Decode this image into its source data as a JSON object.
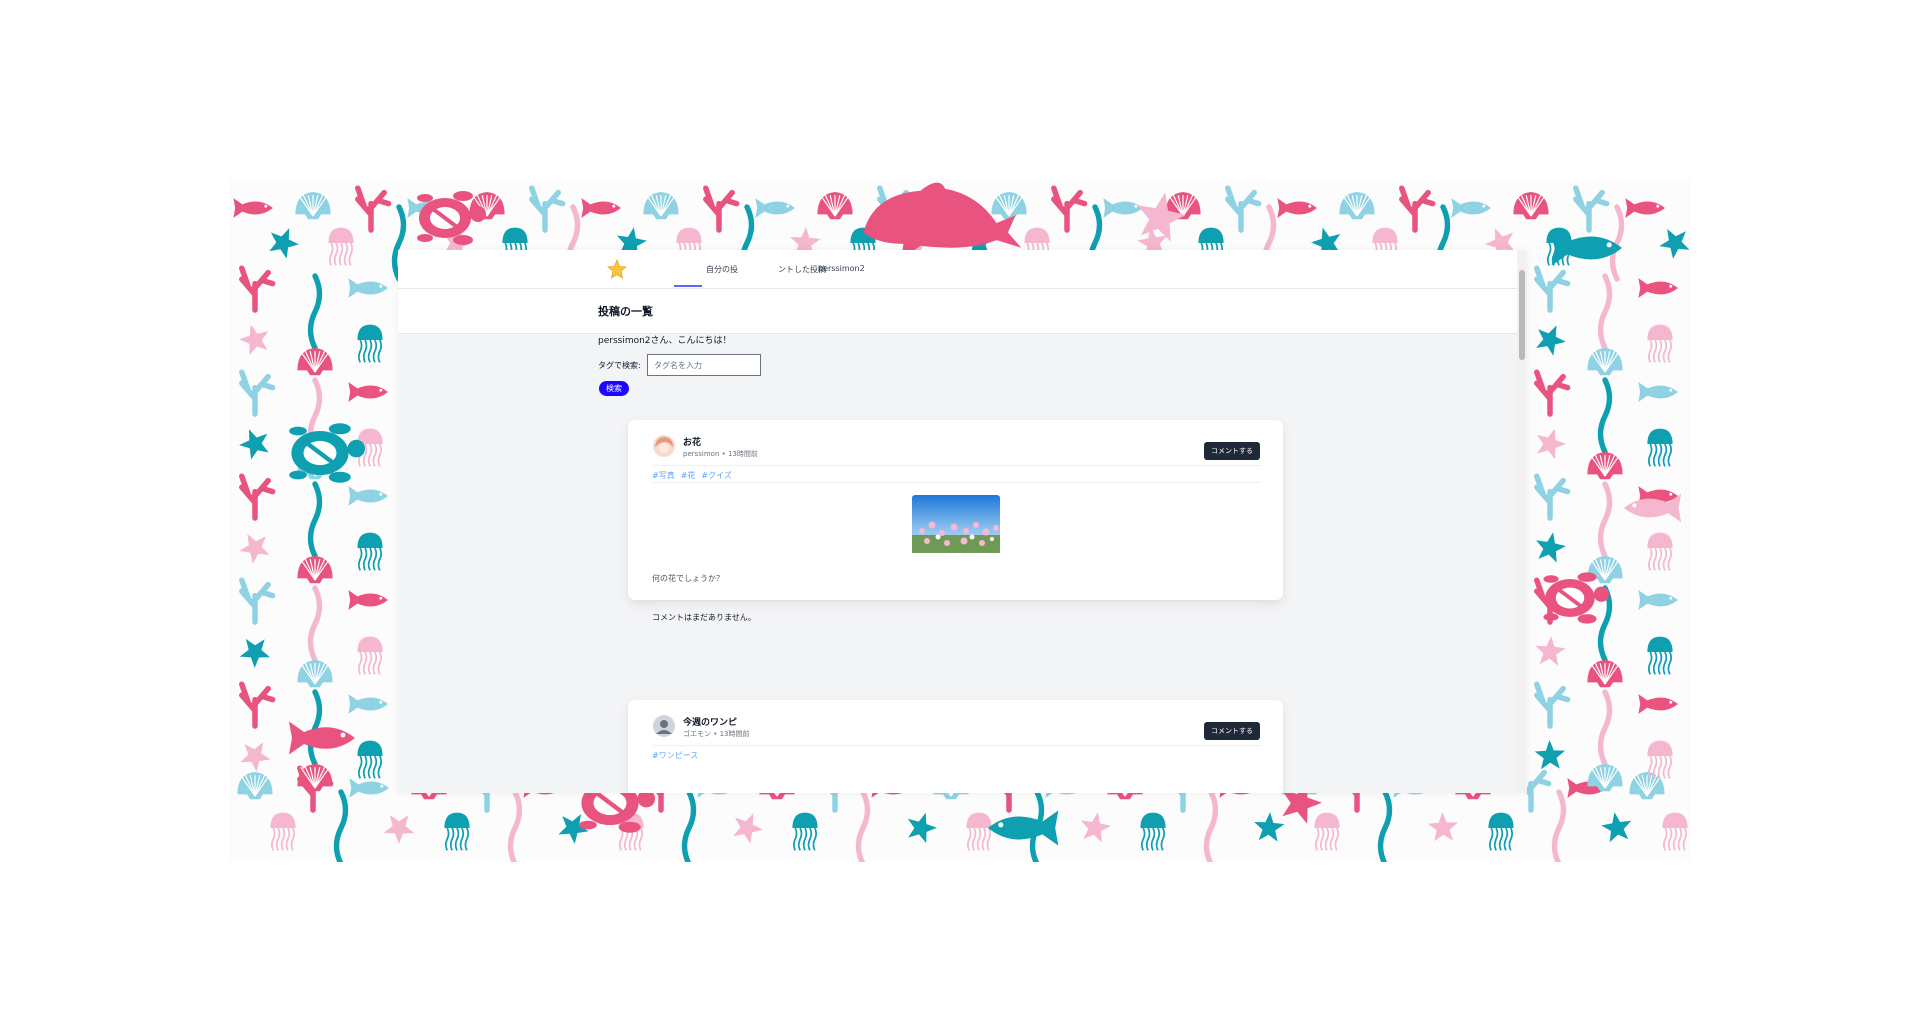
{
  "nav": {
    "items": [
      "自分の投",
      "ントした投稿",
      "perssimon2"
    ]
  },
  "header": {
    "title": "投稿の一覧"
  },
  "greeting": "perssimon2さん、こんにちは！",
  "search": {
    "label": "タグで検索:",
    "placeholder": "タグ名を入力",
    "button": "検索"
  },
  "posts": [
    {
      "title": "お花",
      "author": "perssimon",
      "time": "13時間前",
      "tags": [
        "#写真",
        "#花",
        "#クイズ"
      ],
      "body": "何の花でしょうか？",
      "comments_text": "コメントはまだありません。",
      "comment_button": "コメントする"
    },
    {
      "title": "今週のワンピ",
      "author": "ゴエモン",
      "time": "13時間前",
      "tags": [
        "#ワンピース"
      ],
      "comment_button": "コメントする"
    }
  ],
  "colors": {
    "teal": "#0e9fb1",
    "pink": "#e9537f",
    "light_pink": "#f4b7cf",
    "light_blue": "#8fd2e3",
    "search_button": "#1d07ff",
    "comment_button": "#1f2937"
  }
}
